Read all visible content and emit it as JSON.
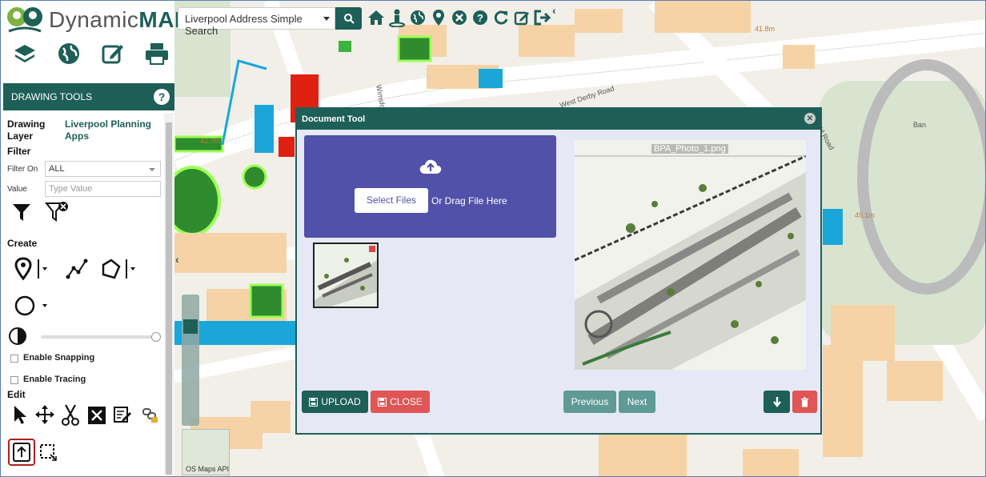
{
  "app": {
    "logo_text_light": "Dynamic",
    "logo_text_bold": "MAPS",
    "header_buttons": [
      "layers-icon",
      "globe-icon",
      "edit-icon",
      "print-icon"
    ]
  },
  "search": {
    "selected": "Liverpool Address Simple Search"
  },
  "toolbar": {
    "icons": [
      "home-icon",
      "street-view-icon",
      "globe-icon",
      "map-marker-icon",
      "close-circle-icon",
      "help-icon",
      "refresh-icon",
      "edit-icon",
      "logout-icon"
    ]
  },
  "sidebar": {
    "header": "DRAWING TOOLS",
    "help": "?",
    "drawing_layer_label": "Drawing Layer",
    "drawing_layer_value": "Liverpool Planning Apps",
    "filter_label": "Filter",
    "filter_on_label": "Filter On",
    "filter_on_value": "ALL",
    "value_label": "Value",
    "value_placeholder": "Type Value",
    "create_label": "Create",
    "enable_snapping": "Enable Snapping",
    "enable_tracing": "Enable Tracing",
    "edit_label": "Edit"
  },
  "map": {
    "labels": {
      "spot1": "41.8m",
      "spot2": "45.1m",
      "spot3": "42.7m",
      "road1": "Wimsford Road",
      "road2": "West Derby Road",
      "road3": "old Road",
      "park": "Ban"
    },
    "os_label": "OS Maps API"
  },
  "document_tool": {
    "title": "Document Tool",
    "select_files": "Select Files",
    "drag_text": "Or Drag File Here",
    "preview_name": "BPA_Photo_1.png",
    "upload": "UPLOAD",
    "close": "CLOSE",
    "previous": "Previous",
    "next": "Next"
  },
  "colors": {
    "brand": "#1e5f58",
    "dropzone": "#5151a9",
    "danger": "#e05555",
    "nav": "#5f9a96"
  }
}
